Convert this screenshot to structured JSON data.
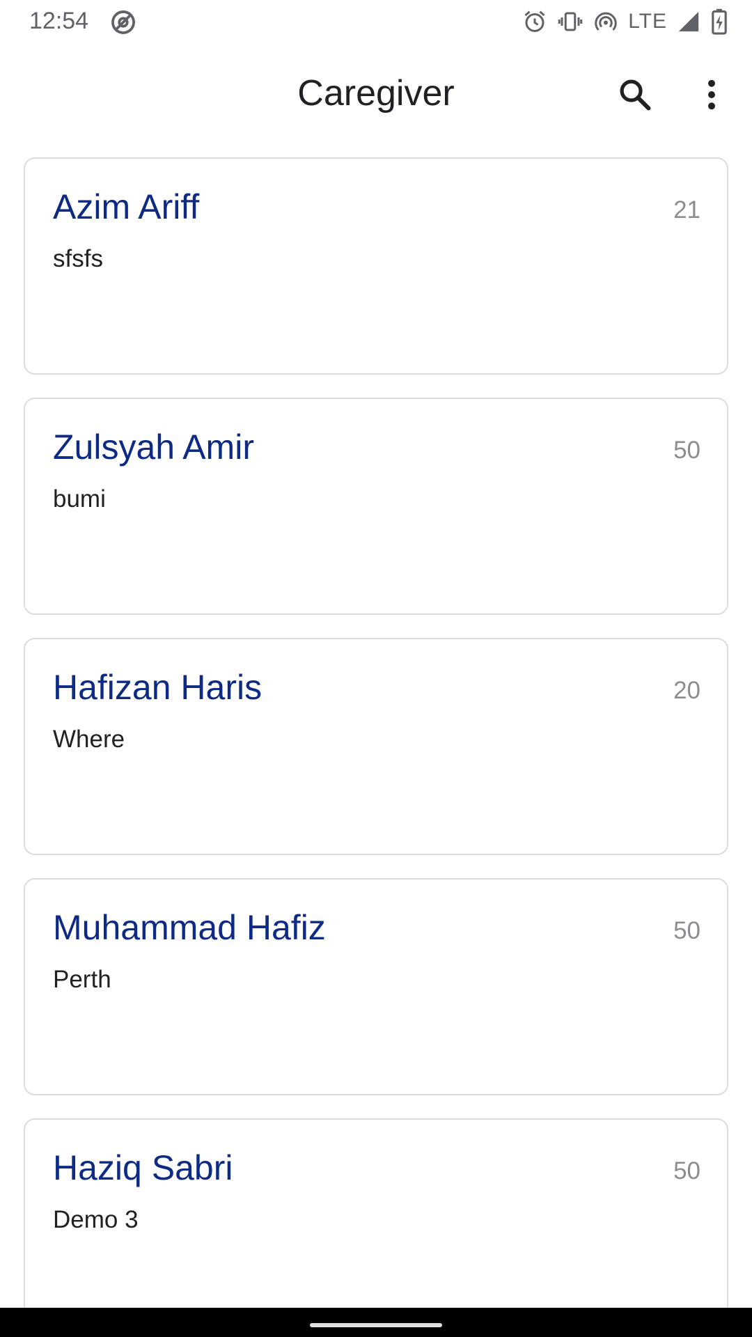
{
  "status_bar": {
    "time": "12:54",
    "network": "LTE",
    "icons": [
      "at-sign-icon",
      "alarm-icon",
      "vibrate-icon",
      "hotspot-icon",
      "signal-icon",
      "battery-charging-icon"
    ]
  },
  "app_bar": {
    "title": "Caregiver",
    "icons": [
      "search-icon",
      "more-vert-icon"
    ]
  },
  "caregivers": [
    {
      "name": "Azim Ariff",
      "age": "21",
      "description": "sfsfs"
    },
    {
      "name": "Zulsyah Amir",
      "age": "50",
      "description": "bumi"
    },
    {
      "name": "Hafizan Haris",
      "age": "20",
      "description": "Where"
    },
    {
      "name": "Muhammad Hafiz",
      "age": "50",
      "description": "Perth"
    },
    {
      "name": "Haziq Sabri",
      "age": "50",
      "description": "Demo 3"
    }
  ],
  "colors": {
    "name_text": "#0d2a85",
    "age_text": "#8a8d91",
    "card_border": "#dadce0",
    "status_icons": "#5f6368"
  }
}
